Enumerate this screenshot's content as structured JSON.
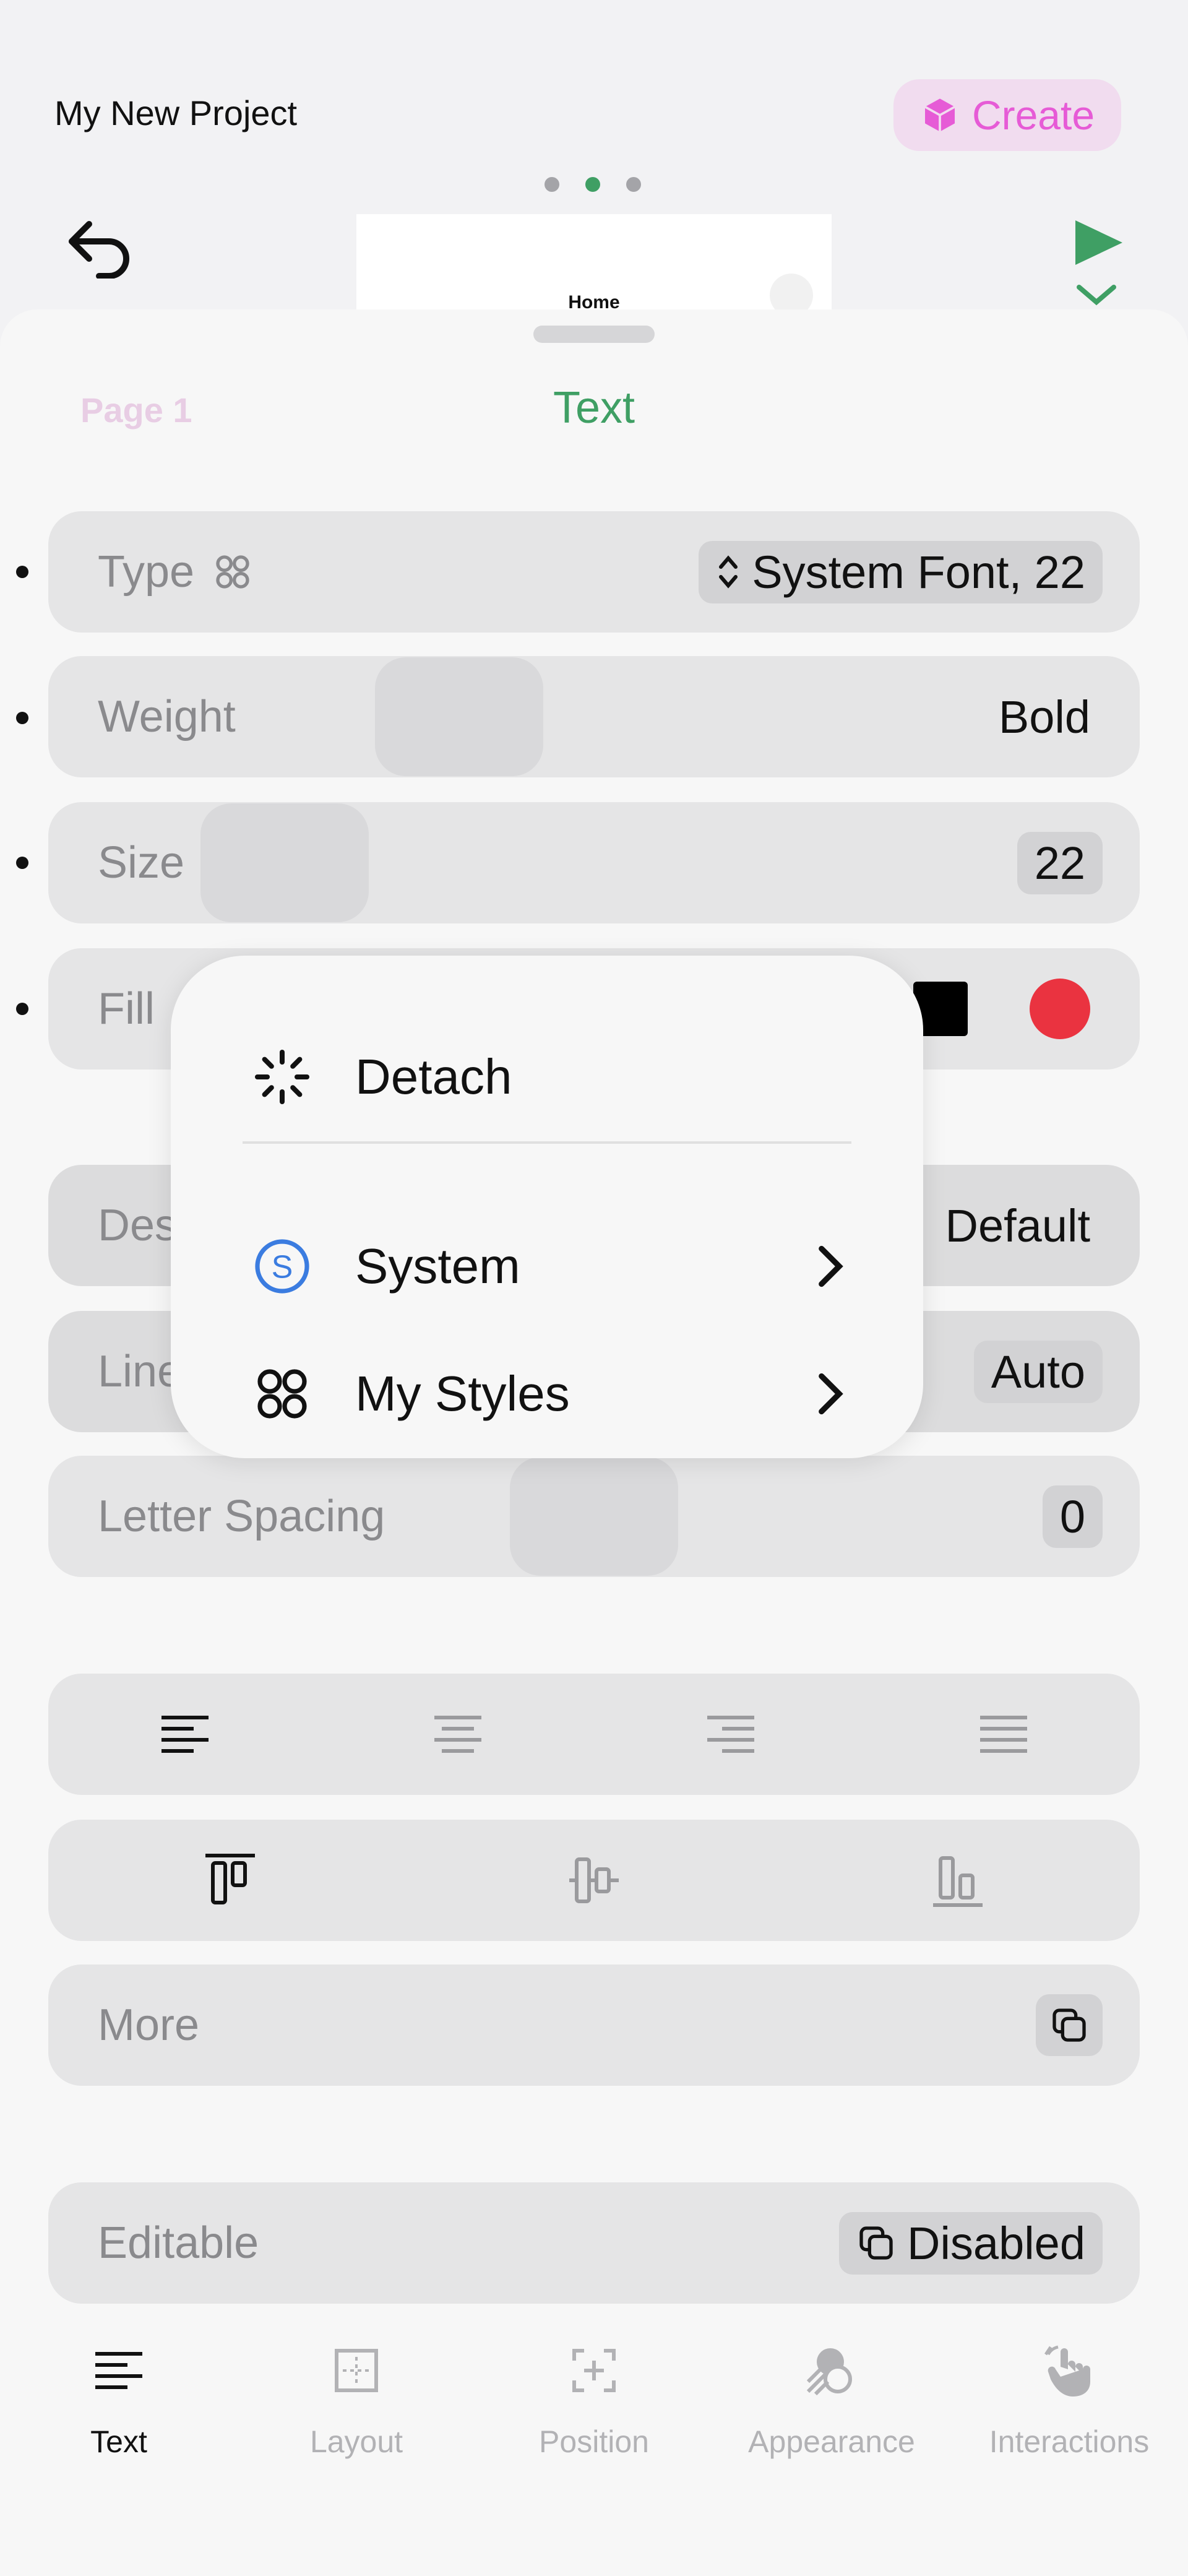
{
  "header": {
    "project_title": "My New Project",
    "create_label": "Create",
    "create_color": "#e65bd6",
    "preview_title": "Home"
  },
  "sheet": {
    "back_label": "Page 1",
    "title": "Text",
    "accent": "#3f9f64"
  },
  "rows": {
    "type": {
      "label": "Type",
      "value": "System Font, 22"
    },
    "weight": {
      "label": "Weight",
      "value": "Bold"
    },
    "size": {
      "label": "Size",
      "value": "22"
    },
    "fill": {
      "label": "Fill",
      "colors": [
        "#000000",
        "#ea3340"
      ]
    },
    "design": {
      "label": "Design",
      "value": "Default"
    },
    "line_height": {
      "label": "Line Height",
      "value": "Auto"
    },
    "letter_spacing": {
      "label": "Letter Spacing",
      "value": "0"
    },
    "more": {
      "label": "More"
    },
    "editable": {
      "label": "Editable",
      "value": "Disabled"
    }
  },
  "menu": {
    "detach": "Detach",
    "system": "System",
    "my_styles": "My Styles"
  },
  "tabs": [
    {
      "label": "Text",
      "icon": "text-align-icon",
      "active": true
    },
    {
      "label": "Layout",
      "icon": "layout-icon",
      "active": false
    },
    {
      "label": "Position",
      "icon": "position-icon",
      "active": false
    },
    {
      "label": "Appearance",
      "icon": "appearance-icon",
      "active": false
    },
    {
      "label": "Interactions",
      "icon": "interactions-icon",
      "active": false
    }
  ]
}
